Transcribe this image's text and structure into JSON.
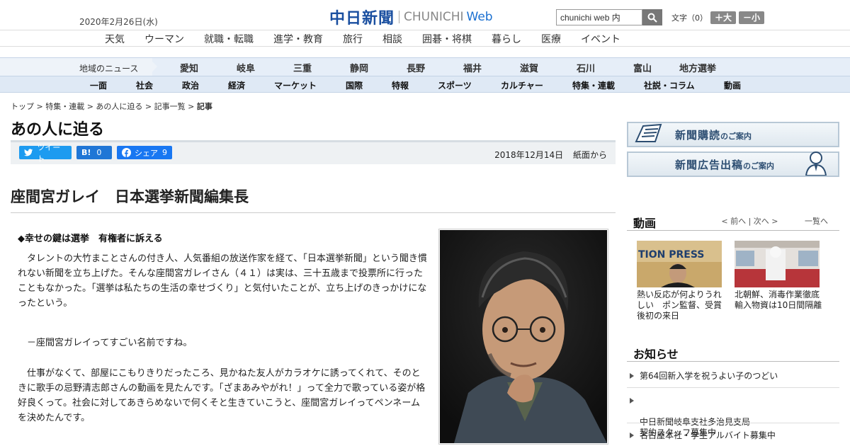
{
  "header": {
    "date": "2020年2月26日(水)",
    "logo_jp": "中日新聞",
    "logo_en": "CHUNICHI",
    "logo_web": "Web",
    "search_value": "chunichi web 内",
    "fontsize_label": "文字（0）",
    "fontsize_plus": "＋大",
    "fontsize_minus": "－小"
  },
  "top_nav": [
    "天気",
    "ウーマン",
    "就職・転職",
    "進学・教育",
    "旅行",
    "相談",
    "囲碁・将棋",
    "暮らし",
    "医療",
    "イベント"
  ],
  "region_nav": {
    "label": "地域のニュース",
    "items": [
      "愛知",
      "岐阜",
      "三重",
      "静岡",
      "長野",
      "福井",
      "滋賀",
      "石川",
      "富山",
      "地方選挙"
    ]
  },
  "genre_nav": [
    "一面",
    "社会",
    "政治",
    "経済",
    "マーケット",
    "国際",
    "特報",
    "スポーツ",
    "カルチャー",
    "特集・連載",
    "社説・コラム",
    "動画"
  ],
  "breadcrumb": {
    "path": "トップ > 特集・連載 > あの人に迫る > 記事一覧 > ",
    "current": "記事"
  },
  "series_title": "あの人に迫る",
  "share": {
    "tweet": "ツイート",
    "hatena_icon": "B!",
    "hatena_count": "0",
    "facebook": "シェア",
    "facebook_count": "9"
  },
  "meta": {
    "date": "2018年12月14日",
    "source": "紙面から"
  },
  "article": {
    "title": "座間宮ガレイ　日本選挙新聞編集長",
    "lead": "◆幸せの鍵は選挙　有権者に訴える",
    "paragraphs": [
      "　タレントの大竹まことさんの付き人、人気番組の放送作家を経て、「日本選挙新聞」という聞き慣れない新聞を立ち上げた。そんな座間宮ガレイさん（４１）は実は、三十五歳まで投票所に行ったこともなかった。「選挙は私たちの生活の幸せづくり」と気付いたことが、立ち上げのきっかけになったという。",
      "　－座間宮ガレイってすごい名前ですね。",
      "　仕事がなくて、部屋にこもりきりだったころ、見かねた友人がカラオケに誘ってくれて、そのときに歌手の忌野清志郎さんの動画を見たんです。「ざまあみやがれ！」って全力で歌っている姿が格好良くって。社会に対してあきらめないで何くそと生きていこうと、座間宮ガレイってペンネームを決めたんです。"
    ]
  },
  "sidebar": {
    "banner1": {
      "main": "新聞購読",
      "sub": "のご案内"
    },
    "banner2": {
      "main": "新聞広告出稿",
      "sub": "のご案内"
    },
    "video": {
      "title": "動画",
      "prev": "< 前へ",
      "next": "次へ >",
      "list": "一覧へ",
      "items": [
        {
          "caption": "熱い反応が何よりうれしい　ポン監督、受賞後初の来日",
          "thumb_text": "TION PRESS"
        },
        {
          "caption": "北朝鮮、消毒作業徹底　輸入物資は10日間隔離",
          "thumb_text": ""
        }
      ]
    },
    "notices": {
      "title": "お知らせ",
      "items": [
        "第64回新入学を祝うよい子のつどい",
        "中日新聞岐阜支社多治見支局\n契約スタッフ募集中",
        "名古屋本社・学生アルバイト募集中"
      ]
    }
  }
}
